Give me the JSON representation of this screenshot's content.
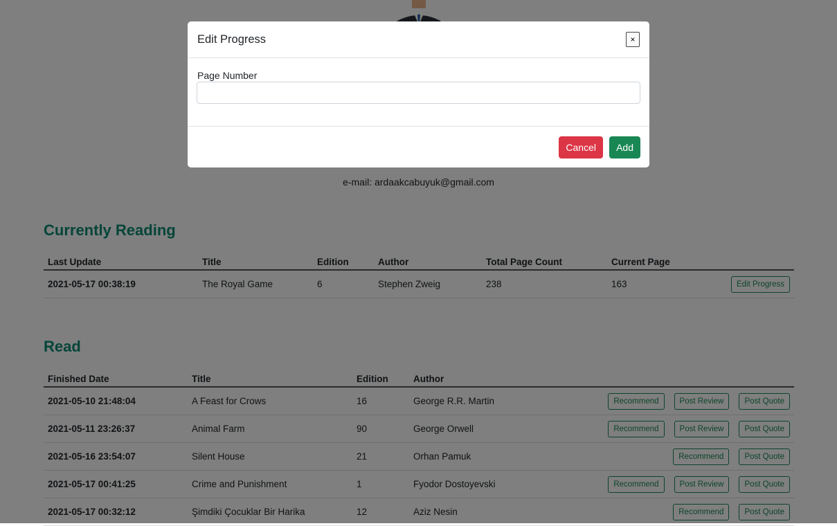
{
  "profile": {
    "email_text": "e-mail: ardaakcabuyuk@gmail.com"
  },
  "currently_reading": {
    "title": "Currently Reading",
    "columns": [
      "Last Update",
      "Title",
      "Edition",
      "Author",
      "Total Page Count",
      "Current Page"
    ],
    "rows": [
      {
        "date": "2021-05-17 00:38:19",
        "title": "The Royal Game",
        "edition": "6",
        "author": "Stephen Zweig",
        "total_pages": "238",
        "current_page": "163",
        "action": "Edit Progress"
      }
    ]
  },
  "read": {
    "title": "Read",
    "columns": [
      "Finished Date",
      "Title",
      "Edition",
      "Author"
    ],
    "buttons": {
      "recommend": "Recommend",
      "post_review": "Post Review",
      "post_quote": "Post Quote"
    },
    "rows": [
      {
        "date": "2021-05-10 21:48:04",
        "title": "A Feast for Crows",
        "edition": "16",
        "author": "George R.R. Martin"
      },
      {
        "date": "2021-05-11 23:26:37",
        "title": "Animal Farm",
        "edition": "90",
        "author": "George Orwell"
      },
      {
        "date": "2021-05-16 23:54:07",
        "title": "Silent House",
        "edition": "21",
        "author": "Orhan Pamuk"
      },
      {
        "date": "2021-05-17 00:41:25",
        "title": "Crime and Punishment",
        "edition": "1",
        "author": "Fyodor Dostoyevski"
      },
      {
        "date": "2021-05-17 00:32:12",
        "title": "Şimdiki Çocuklar Bir Harika",
        "edition": "12",
        "author": "Aziz Nesin"
      }
    ]
  },
  "modal": {
    "title": "Edit Progress",
    "close_glyph": "×",
    "field_label": "Page Number",
    "field_value": "",
    "field_placeholder": "",
    "cancel_label": "Cancel",
    "add_label": "Add"
  },
  "colors": {
    "accent": "#0d8a72",
    "success": "#198754",
    "danger": "#dc3545"
  }
}
